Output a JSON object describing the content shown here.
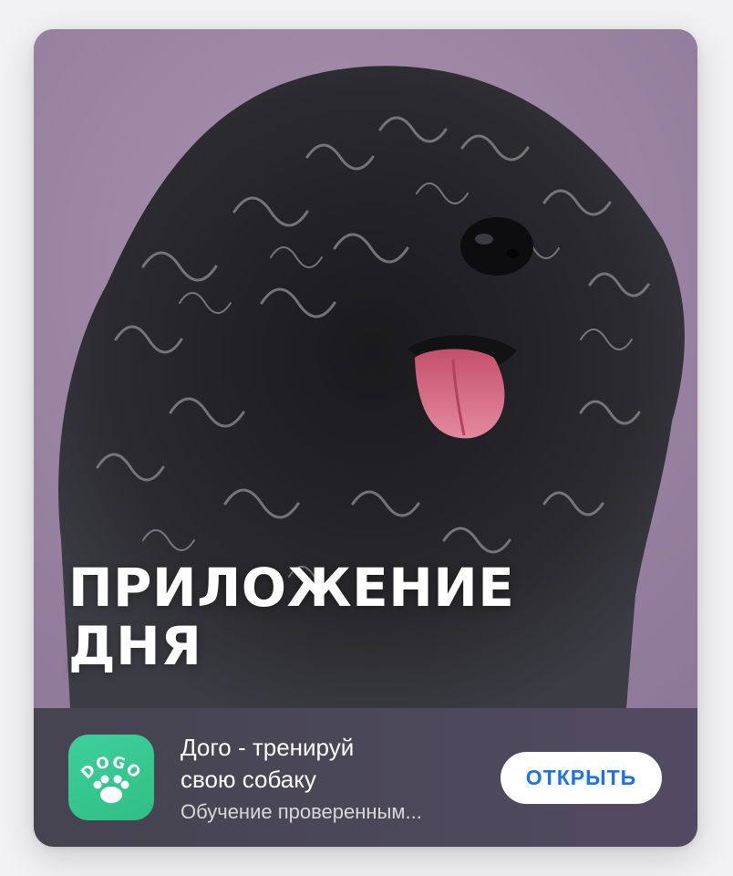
{
  "card": {
    "headline_line1": "ПРИЛОЖЕНИЕ",
    "headline_line2": "ДНЯ",
    "hero_image": "black curly-coated dog with tongue out on purple background"
  },
  "app": {
    "icon_label": "DOGO",
    "title_line1": "Дого - тренируй",
    "title_line2": "свою собаку",
    "subtitle": "Обучение проверенным...",
    "open_button_label": "ОТКРЫТЬ"
  },
  "colors": {
    "hero_background": "#9d86a6",
    "footer_background": "#4a4757",
    "icon_green": "#34c98f",
    "button_text": "#1a73e8"
  }
}
